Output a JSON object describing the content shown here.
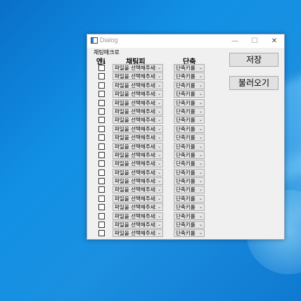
{
  "window": {
    "title": "Dialog",
    "minimize_glyph": "—",
    "maximize_glyph": "☐",
    "close_glyph": "✕"
  },
  "group_label": "채팅매크로",
  "columns": {
    "enable": "엔i",
    "channel": "채팅피",
    "shortcut": "단축"
  },
  "row_count": 20,
  "rows": [
    {
      "file": "파일을 선택해주세요",
      "shortcut": "단축키를"
    },
    {
      "file": "파일을 선택해주세요",
      "shortcut": "단축키를"
    },
    {
      "file": "파일을 선택해주세요",
      "shortcut": "단축키를"
    },
    {
      "file": "파일을 선택해주세요",
      "shortcut": "단축키를"
    },
    {
      "file": "파일을 선택해주세요",
      "shortcut": "단축키를"
    },
    {
      "file": "파일을 선택해주세요",
      "shortcut": "단축키를"
    },
    {
      "file": "파일을 선택해주세요",
      "shortcut": "단축키를"
    },
    {
      "file": "파일을 선택해주세요",
      "shortcut": "단축키를"
    },
    {
      "file": "파일을 선택해주세요",
      "shortcut": "단축키를"
    },
    {
      "file": "파일을 선택해주세요",
      "shortcut": "단축키를"
    },
    {
      "file": "파일을 선택해주세요",
      "shortcut": "단축키를"
    },
    {
      "file": "파일을 선택해주세요",
      "shortcut": "단축키를"
    },
    {
      "file": "파일을 선택해주세요",
      "shortcut": "단축키를"
    },
    {
      "file": "파일을 선택해주세요",
      "shortcut": "단축키를"
    },
    {
      "file": "파일을 선택해주세요",
      "shortcut": "단축키를"
    },
    {
      "file": "파일을 선택해주세요",
      "shortcut": "단축키를"
    },
    {
      "file": "파일을 선택해주세요",
      "shortcut": "단축키를"
    },
    {
      "file": "파일을 선택해주세요",
      "shortcut": "단축키를"
    },
    {
      "file": "파일을 선택해주세요",
      "shortcut": "단축키를"
    },
    {
      "file": "파일을 선택해주세요",
      "shortcut": "단축키를"
    }
  ],
  "buttons": {
    "save": "저장",
    "load": "불러오기"
  },
  "icons": {
    "app": "dialog-app-icon",
    "dropdown": "chevron-down-icon"
  }
}
